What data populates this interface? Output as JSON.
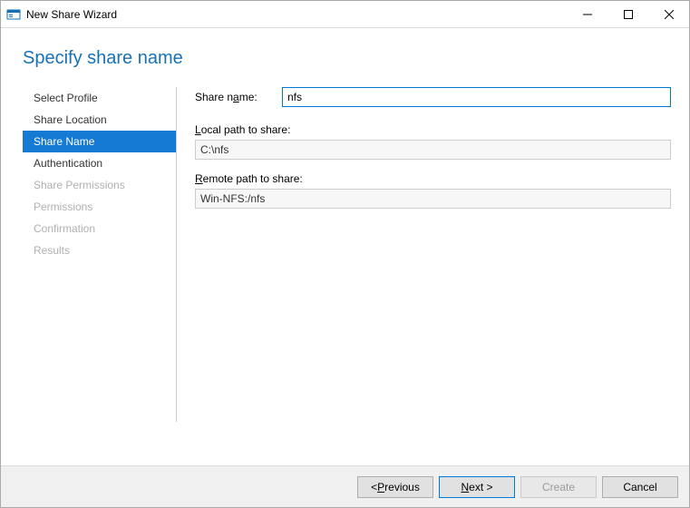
{
  "window": {
    "title": "New Share Wizard"
  },
  "heading": "Specify share name",
  "nav": {
    "items": [
      {
        "label": "Select Profile",
        "state": "done"
      },
      {
        "label": "Share Location",
        "state": "done"
      },
      {
        "label": "Share Name",
        "state": "active"
      },
      {
        "label": "Authentication",
        "state": "done"
      },
      {
        "label": "Share Permissions",
        "state": "disabled"
      },
      {
        "label": "Permissions",
        "state": "disabled"
      },
      {
        "label": "Confirmation",
        "state": "disabled"
      },
      {
        "label": "Results",
        "state": "disabled"
      }
    ]
  },
  "form": {
    "share_name_label": "Share name:",
    "share_name_value": "nfs",
    "local_path_label": "Local path to share:",
    "local_path_value": "C:\\nfs",
    "remote_path_label": "Remote path to share:",
    "remote_path_value": "Win-NFS:/nfs"
  },
  "footer": {
    "previous": "Previous",
    "next": "Next",
    "create": "Create",
    "cancel": "Cancel"
  }
}
